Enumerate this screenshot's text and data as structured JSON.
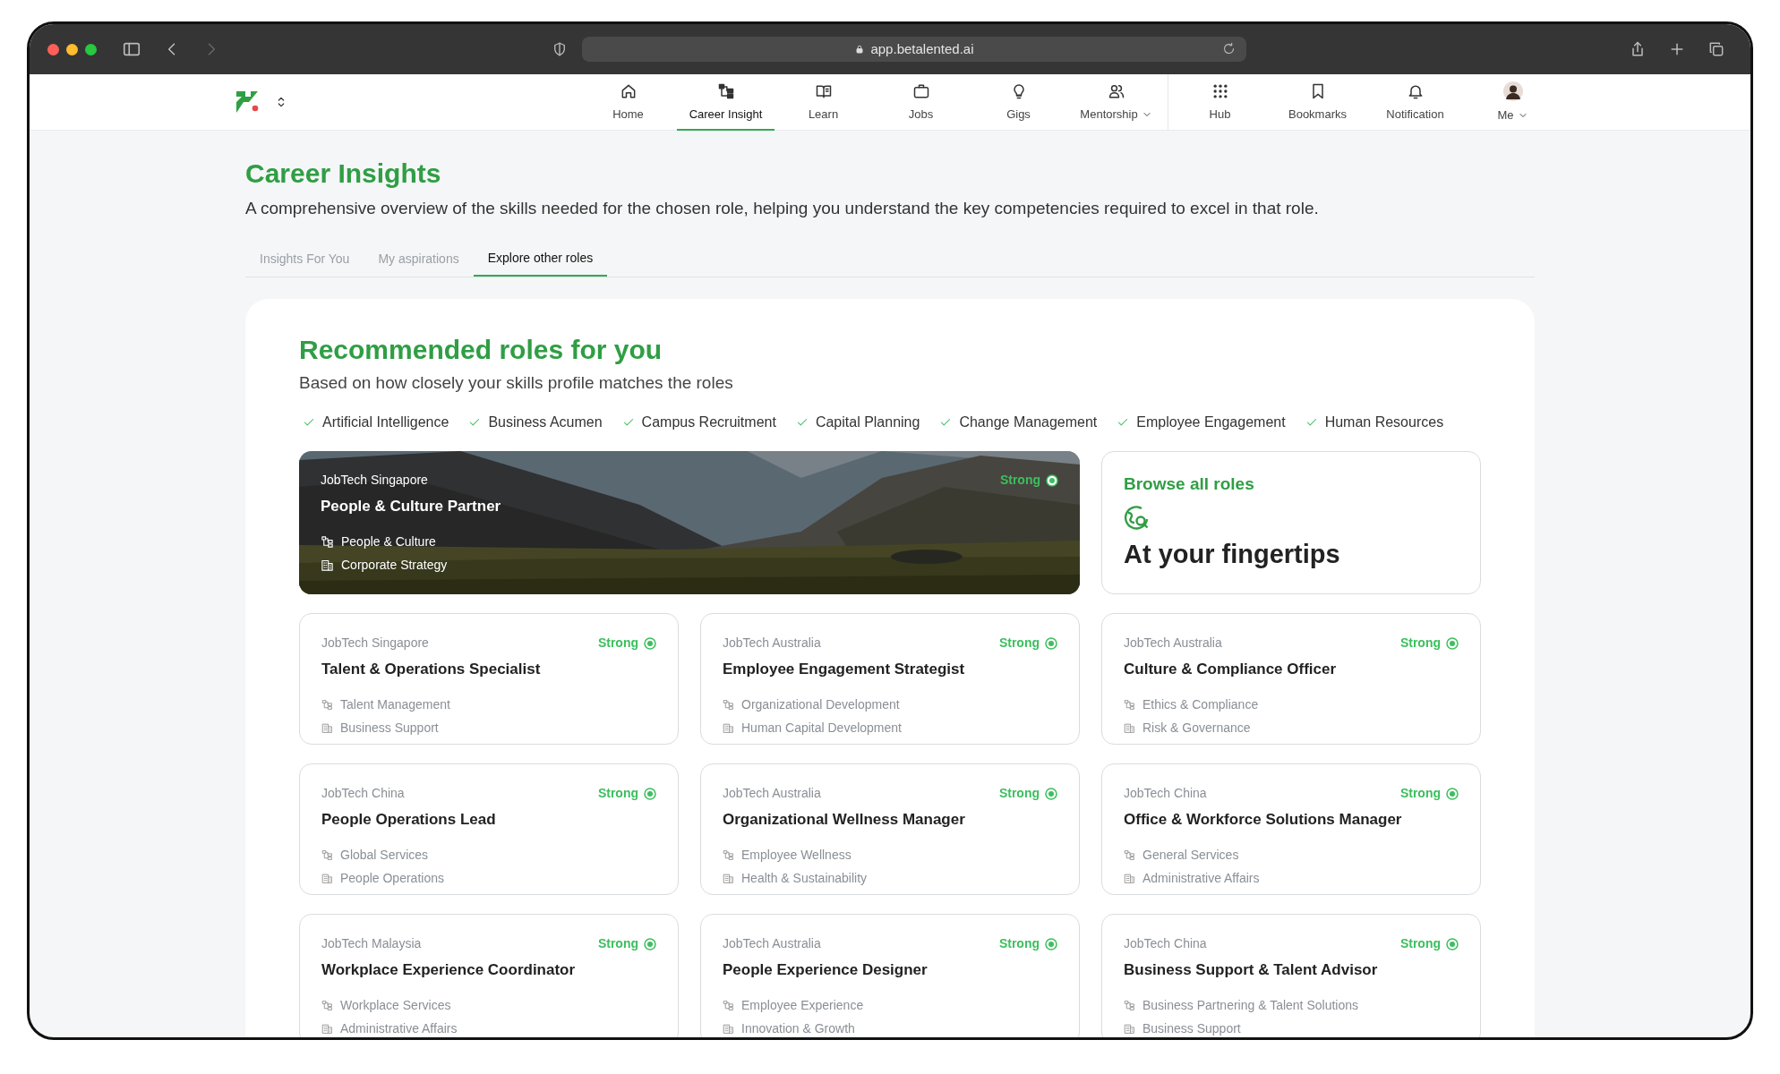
{
  "browser": {
    "url": "app.betalented.ai"
  },
  "nav": {
    "main": [
      {
        "label": "Home",
        "selected": false,
        "has_menu": false
      },
      {
        "label": "Career Insight",
        "selected": true,
        "has_menu": false
      },
      {
        "label": "Learn",
        "selected": false,
        "has_menu": false
      },
      {
        "label": "Jobs",
        "selected": false,
        "has_menu": false
      },
      {
        "label": "Gigs",
        "selected": false,
        "has_menu": false
      },
      {
        "label": "Mentorship",
        "selected": false,
        "has_menu": true
      }
    ],
    "personal": [
      {
        "label": "Hub",
        "selected": false,
        "has_menu": false
      },
      {
        "label": "Bookmarks",
        "selected": false,
        "has_menu": false
      },
      {
        "label": "Notification",
        "selected": false,
        "has_menu": false
      },
      {
        "label": "Me",
        "selected": false,
        "has_menu": true
      }
    ]
  },
  "page": {
    "title": "Career Insights",
    "subtitle": "A comprehensive overview of the skills needed for the chosen role, helping you understand the key competencies required to excel in that role.",
    "tabs": [
      {
        "label": "Insights For You",
        "selected": false
      },
      {
        "label": "My aspirations",
        "selected": false
      },
      {
        "label": "Explore other roles",
        "selected": true
      }
    ]
  },
  "section": {
    "title": "Recommended roles for you",
    "subtitle": "Based on how closely your skills profile matches the roles",
    "skills": [
      "Artificial Intelligence",
      "Business Acumen",
      "Campus Recruitment",
      "Capital Planning",
      "Change Management",
      "Employee Engagement",
      "Human Resources"
    ],
    "featured": {
      "kind": "picture",
      "company": "JobTech Singapore",
      "title": "People & Culture Partner",
      "strength": "Strong",
      "category": "People & Culture",
      "department": "Corporate Strategy"
    },
    "browse": {
      "title": "Browse all roles",
      "tagline": "At your fingertips"
    },
    "roles": [
      {
        "company": "JobTech Singapore",
        "title": "Talent & Operations Specialist",
        "strength": "Strong",
        "category": "Talent Management",
        "department": "Business Support"
      },
      {
        "company": "JobTech Australia",
        "title": "Employee Engagement Strategist",
        "strength": "Strong",
        "category": "Organizational Development",
        "department": "Human Capital Development"
      },
      {
        "company": "JobTech Australia",
        "title": "Culture & Compliance Officer",
        "strength": "Strong",
        "category": "Ethics & Compliance",
        "department": "Risk & Governance"
      },
      {
        "company": "JobTech China",
        "title": "People Operations Lead",
        "strength": "Strong",
        "category": "Global Services",
        "department": "People Operations"
      },
      {
        "company": "JobTech Australia",
        "title": "Organizational Wellness Manager",
        "strength": "Strong",
        "category": "Employee Wellness",
        "department": "Health & Sustainability"
      },
      {
        "company": "JobTech China",
        "title": "Office & Workforce Solutions Manager",
        "strength": "Strong",
        "category": "General Services",
        "department": "Administrative Affairs"
      },
      {
        "company": "JobTech Malaysia",
        "title": "Workplace Experience Coordinator",
        "strength": "Strong",
        "category": "Workplace Services",
        "department": "Administrative Affairs"
      },
      {
        "company": "JobTech Australia",
        "title": "People Experience Designer",
        "strength": "Strong",
        "category": "Employee Experience",
        "department": "Innovation & Growth"
      },
      {
        "company": "JobTech China",
        "title": "Business Support & Talent Advisor",
        "strength": "Strong",
        "category": "Business Partnering & Talent Solutions",
        "department": "Business Support"
      }
    ]
  }
}
